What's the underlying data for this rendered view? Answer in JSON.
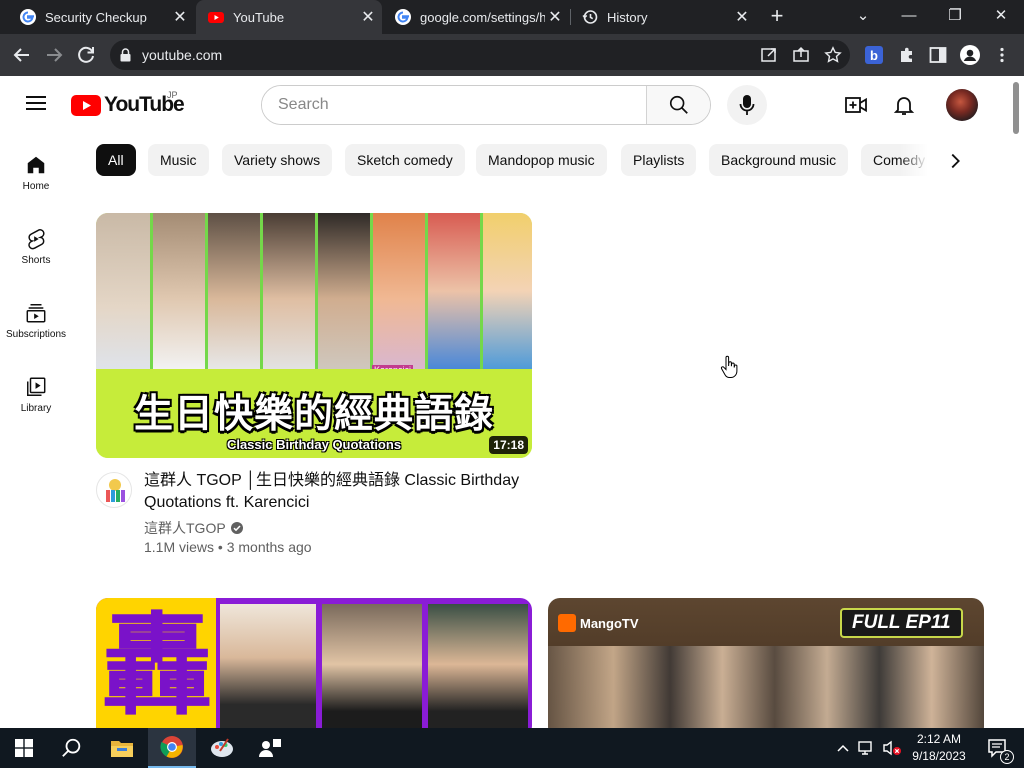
{
  "browser": {
    "tabs": [
      {
        "title": "Security Checkup",
        "icon": "google-icon",
        "active": false
      },
      {
        "title": "YouTube",
        "icon": "youtube-icon",
        "active": true
      },
      {
        "title": "google.com/settings/h",
        "icon": "google-icon",
        "active": false
      },
      {
        "title": "History",
        "icon": "history-icon",
        "active": false
      }
    ],
    "tab_close": "✕",
    "new_tab": "+",
    "window": {
      "minimize": "—",
      "restore": "❐",
      "close": "✕",
      "tabsearch": "⌄"
    },
    "url": "youtube.com"
  },
  "youtube": {
    "logo_text": "YouTube",
    "country_code": "JP",
    "search_placeholder": "Search",
    "guide": [
      {
        "label": "Home",
        "icon": "home-icon"
      },
      {
        "label": "Shorts",
        "icon": "shorts-icon"
      },
      {
        "label": "Subscriptions",
        "icon": "subscriptions-icon"
      },
      {
        "label": "Library",
        "icon": "library-icon"
      }
    ],
    "chips": [
      "All",
      "Music",
      "Variety shows",
      "Sketch comedy",
      "Mandopop music",
      "Playlists",
      "Background music",
      "Comedy"
    ],
    "active_chip": "All",
    "videos": [
      {
        "thumbnail_text": "生日快樂的經典語錄",
        "thumbnail_subtext": "Classic Birthday Quotations",
        "thumbnail_tag": "Karencici",
        "duration": "17:18",
        "title": "這群人 TGOP │生日快樂的經典語錄 Classic Birthday Quotations ft. Karencici",
        "channel": "這群人TGOP",
        "views": "1.1M views",
        "age": "3 months ago",
        "stats_sep": "•"
      },
      {
        "thumbnail_text": "轟"
      },
      {
        "thumbnail_brand": "MangoTV",
        "thumbnail_badge": "FULL EP11"
      }
    ],
    "colors": {
      "brand_red": "#ff0000",
      "chip_active": "#0f0f0f",
      "chip_bg": "#f2f2f2"
    }
  },
  "taskbar": {
    "apps": [
      "start-icon",
      "search-icon",
      "file-explorer-icon",
      "chrome-icon",
      "paint-icon",
      "people-icon"
    ],
    "time": "2:12 AM",
    "date": "9/18/2023",
    "notification_count": "2"
  }
}
